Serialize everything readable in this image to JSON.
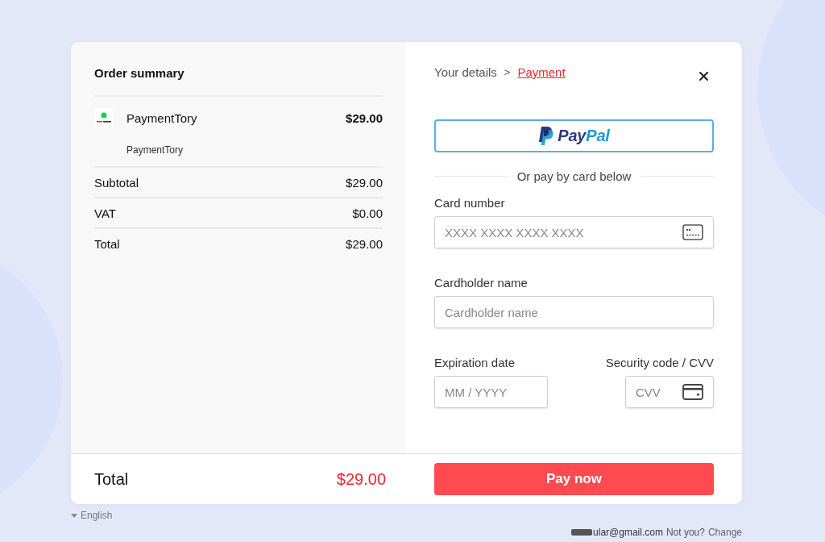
{
  "order_summary": {
    "title": "Order summary",
    "item": {
      "name": "PaymentTory",
      "price": "$29.00",
      "description": "PaymentTory"
    },
    "lines": [
      {
        "label": "Subtotal",
        "value": "$29.00"
      },
      {
        "label": "VAT",
        "value": "$0.00"
      },
      {
        "label": "Total",
        "value": "$29.00"
      }
    ]
  },
  "breadcrumb": {
    "items": [
      {
        "label": "Your details",
        "selected": false
      },
      {
        "label": "Payment",
        "selected": true
      }
    ],
    "separator": ">"
  },
  "paypal_button": {
    "wordmark": [
      "Pay",
      "Pal"
    ]
  },
  "divider_text": "Or pay by card below",
  "fields": [
    {
      "kind": "card_number",
      "label": "Card number",
      "placeholder": "XXXX XXXX XXXX XXXX"
    },
    {
      "kind": "name",
      "label": "Cardholder name",
      "placeholder": "Cardholder name"
    },
    {
      "kind": "expiry",
      "label": "Expiration date",
      "placeholder": "MM / YYYY"
    },
    {
      "kind": "cvv",
      "label": "Security code / CVV",
      "placeholder": "CVV"
    }
  ],
  "footer": {
    "total_label": "Total",
    "total_value": "$29.00",
    "pay_button": "Pay now"
  },
  "language": {
    "label": "English"
  },
  "account": {
    "email": "ular@gmail.com",
    "prompt": "Not you?",
    "link": "Change"
  }
}
